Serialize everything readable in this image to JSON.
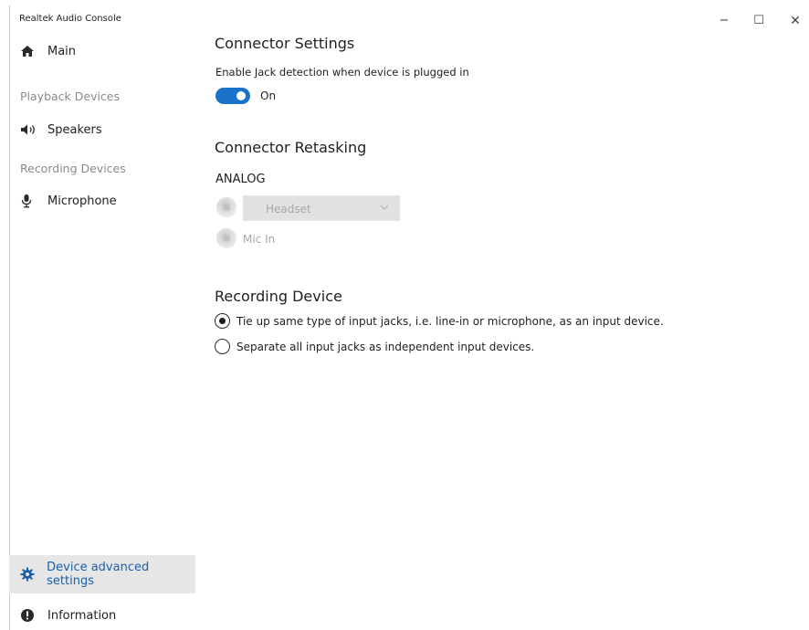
{
  "window": {
    "title": "Realtek Audio Console",
    "minimize_glyph": "−",
    "maximize_glyph": "☐",
    "close_glyph": "✕"
  },
  "sidebar": {
    "main_label": "Main",
    "playback_header": "Playback Devices",
    "speakers_label": "Speakers",
    "recording_header": "Recording Devices",
    "microphone_label": "Microphone",
    "advanced_label": "Device advanced settings",
    "information_label": "Information"
  },
  "connector_settings": {
    "heading": "Connector Settings",
    "jack_detection_label": "Enable Jack detection when device is plugged in",
    "toggle_on": true,
    "toggle_state_label": "On"
  },
  "connector_retasking": {
    "heading": "Connector Retasking",
    "group_label": "ANALOG",
    "jack1_selected": "Headset",
    "jack2_label": "Mic In"
  },
  "recording_device": {
    "heading": "Recording Device",
    "option1": "Tie up same type of input jacks, i.e. line-in or microphone, as an input device.",
    "option2": "Separate all input jacks as independent input devices.",
    "selected_option": 1
  },
  "colors": {
    "accent": "#1a73c8",
    "selected_nav_bg": "#e6e6e6",
    "selected_nav_text": "#1a5fa8",
    "disabled_text": "#a8a8a8"
  },
  "icons": {
    "main": "home-icon",
    "speakers": "speaker-icon",
    "microphone": "microphone-icon",
    "advanced": "gear-icon",
    "information": "info-icon"
  }
}
